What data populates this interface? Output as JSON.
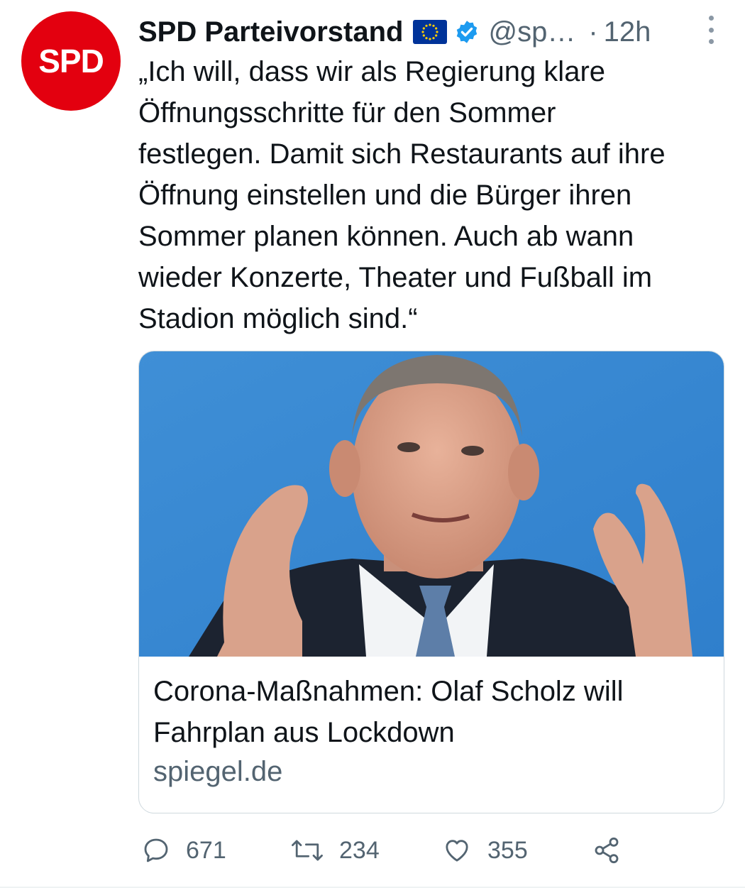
{
  "avatar": {
    "text": "SPD",
    "color": "#e3000f"
  },
  "tweet": {
    "name": "SPD Parteivorstand",
    "handle": "@sp…",
    "separator": "·",
    "time": "12h",
    "text": "„Ich will, dass wir als Regierung klare\nÖffnungsschritte für den Sommer\nfestlegen. Damit sich Restaurants auf ihre\nÖffnung einstellen und die Bürger ihren\nSommer planen können. Auch ab wann\nwieder Konzerte, Theater und Fußball im\nStadion möglich sind.“"
  },
  "card": {
    "title": "Corona-Maßnahmen: Olaf Scholz will\nFahrplan aus Lockdown",
    "domain": "spiegel.de"
  },
  "actions": {
    "replies": "671",
    "retweets": "234",
    "likes": "355"
  },
  "icons": {
    "reply": "reply-bubble-icon",
    "retweet": "retweet-icon",
    "like": "heart-icon",
    "share": "share-icon",
    "more": "more-vertical-icon",
    "verified": "verified-badge-icon",
    "flag": "eu-flag-icon"
  },
  "colors": {
    "accent": "#1d9bf0",
    "secondary_text": "#536471",
    "eu_blue": "#003399",
    "eu_gold": "#ffcc00"
  }
}
